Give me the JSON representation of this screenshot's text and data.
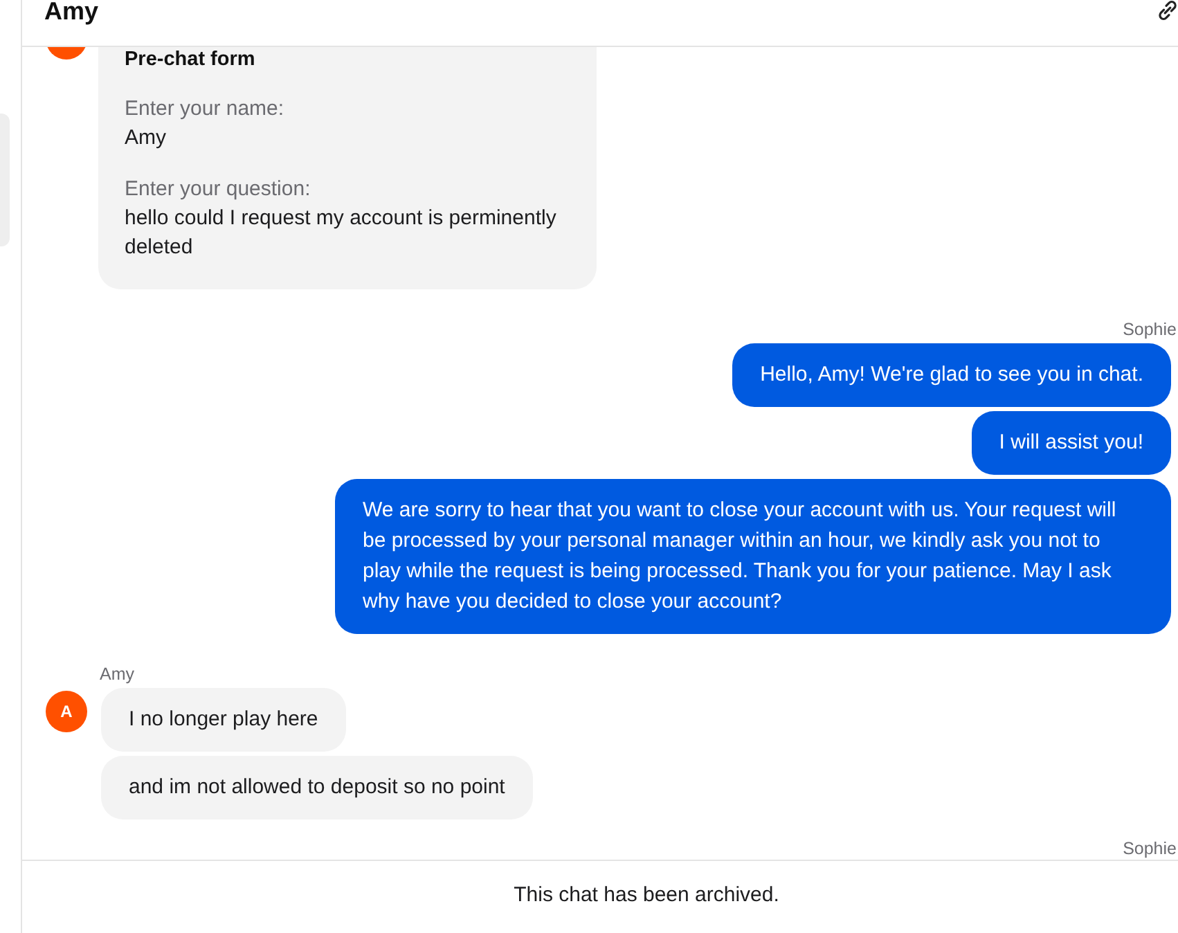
{
  "header": {
    "title": "Amy"
  },
  "messages": [
    {
      "kind": "form",
      "title": "Pre-chat form",
      "fields": [
        {
          "label": "Enter your name:",
          "value": "Amy"
        },
        {
          "label": "Enter your question:",
          "value": "hello could I request my account is perminently deleted"
        }
      ]
    },
    {
      "kind": "agent",
      "author": "Sophie",
      "bubbles": [
        "Hello, Amy! We're glad to see you in chat.",
        "I will assist you!",
        "We are sorry to hear that you want to close your account with us. Your request will be processed by your personal manager within an hour, we kindly ask you not to play while the request is being processed. Thank you for your patience. May I ask why have you decided to close your account?"
      ]
    },
    {
      "kind": "customer",
      "author": "Amy",
      "avatar": "A",
      "bubbles": [
        "I no longer play here",
        "and im not allowed to deposit so no point"
      ]
    },
    {
      "kind": "agent",
      "author": "Sophie"
    }
  ],
  "footer": {
    "notice": "This chat has been archived."
  }
}
